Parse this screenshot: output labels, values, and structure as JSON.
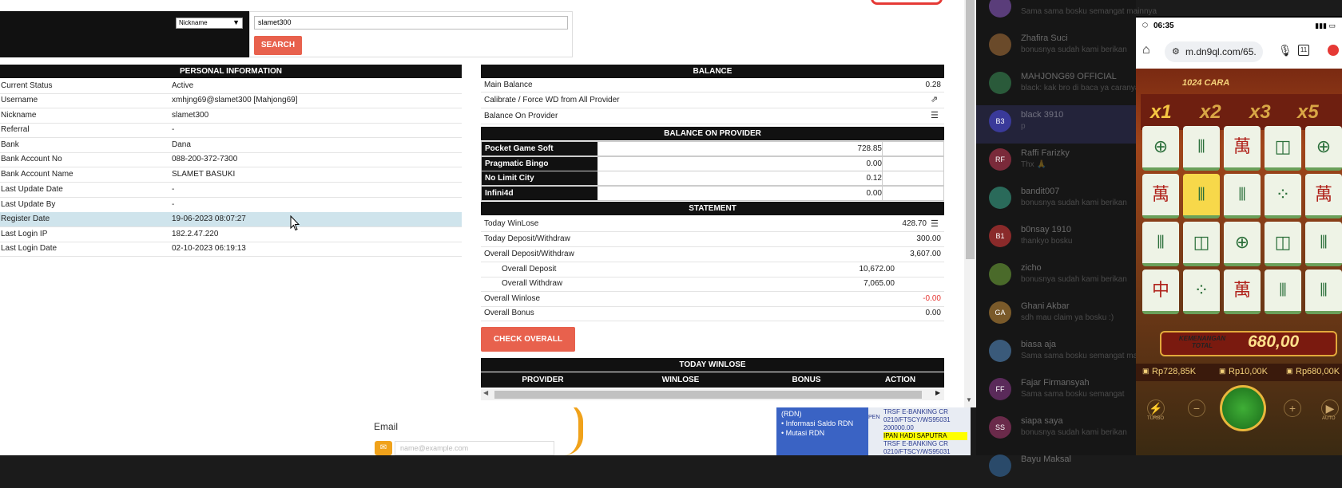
{
  "search": {
    "field_select": "Nickname",
    "query": "slamet300",
    "button": "SEARCH"
  },
  "personal": {
    "header": "PERSONAL INFORMATION",
    "rows": [
      {
        "label": "Current Status",
        "value": "Active"
      },
      {
        "label": "Username",
        "value": "xmhjng69@slamet300  [Mahjong69]"
      },
      {
        "label": "Nickname",
        "value": "slamet300"
      },
      {
        "label": "Referral",
        "value": "-"
      },
      {
        "label": "Bank",
        "value": "Dana"
      },
      {
        "label": "Bank Account No",
        "value": "088-200-372-7300"
      },
      {
        "label": "Bank Account Name",
        "value": "SLAMET BASUKI"
      },
      {
        "label": "Last Update Date",
        "value": "-"
      },
      {
        "label": "Last Update By",
        "value": "-"
      },
      {
        "label": "Register Date",
        "value": "19-06-2023 08:07:27"
      },
      {
        "label": "Last Login IP",
        "value": "182.2.47.220"
      },
      {
        "label": "Last Login Date",
        "value": "02-10-2023 06:19:13"
      }
    ]
  },
  "balance": {
    "header": "BALANCE",
    "main_label": "Main Balance",
    "main_value": "0.28",
    "calibrate_label": "Calibrate / Force WD from All Provider",
    "on_provider_label": "Balance On Provider",
    "provider_header": "BALANCE ON PROVIDER",
    "providers": [
      {
        "name": "Pocket Game Soft",
        "amount": "728.85"
      },
      {
        "name": "Pragmatic Bingo",
        "amount": "0.00"
      },
      {
        "name": "No Limit City",
        "amount": "0.12"
      },
      {
        "name": "Infini4d",
        "amount": "0.00"
      }
    ]
  },
  "statement": {
    "header": "STATEMENT",
    "today_winlose_label": "Today WinLose",
    "today_winlose": "428.70",
    "today_dw_label": "Today Deposit/Withdraw",
    "today_dw": "300.00",
    "overall_dw_label": "Overall Deposit/Withdraw",
    "overall_dw": "3,607.00",
    "overall_deposit_label": "Overall Deposit",
    "overall_deposit": "10,672.00",
    "overall_withdraw_label": "Overall Withdraw",
    "overall_withdraw": "7,065.00",
    "overall_winlose_label": "Overall Winlose",
    "overall_winlose": "-0.00",
    "overall_bonus_label": "Overall Bonus",
    "overall_bonus": "0.00"
  },
  "check_overall_button": "CHECK OVERALL",
  "today_winlose": {
    "header": "TODAY WINLOSE",
    "columns": [
      "PROVIDER",
      "WINLOSE",
      "BONUS",
      "ACTION"
    ]
  },
  "background_page": {
    "email_label": "Email",
    "email_placeholder": "name@example.com",
    "rdn_menu": [
      "(RDN)",
      "• Informasi Saldo RDN",
      "• Mutasi RDN"
    ],
    "pend_label": "PEND",
    "transactions": [
      "TRSF E-BANKING CR 0210/FTSCY/WS95031 200000.00",
      "IPAN HADI SAPUTRA",
      "TRSF E-BANKING CR 0210/FTSCY/WS95031"
    ]
  },
  "chat": [
    {
      "name": "",
      "message": "Sama sama bosku semangat mainnya",
      "initials": ""
    },
    {
      "name": "Zhafira Suci",
      "message": "bonusnya sudah kami berikan",
      "initials": ""
    },
    {
      "name": "MAHJONG69 OFFICIAL",
      "message": "black: kak bro di baca ya caranya",
      "initials": ""
    },
    {
      "name": "black 3910",
      "message": "p",
      "initials": "B3"
    },
    {
      "name": "Raffi Farizky",
      "message": "Thx 🙏",
      "initials": "RF"
    },
    {
      "name": "bandit007",
      "message": "bonusnya sudah kami berikan",
      "initials": ""
    },
    {
      "name": "b0nsay 1910",
      "message": "thankyo bosku",
      "initials": "B1"
    },
    {
      "name": "zicho",
      "message": "bonusnya sudah kami berikan",
      "initials": ""
    },
    {
      "name": "Ghani Akbar",
      "message": "sdh mau claim ya bosku :)",
      "initials": "GA"
    },
    {
      "name": "biasa aja",
      "message": "Sama sama bosku semangat mainnya",
      "initials": ""
    },
    {
      "name": "Fajar Firmansyah",
      "message": "Sama sama bosku semangat",
      "initials": "FF"
    },
    {
      "name": "siapa saya",
      "message": "bonusnya sudah kami berikan",
      "initials": "SS"
    },
    {
      "name": "Bayu Maksal",
      "message": "",
      "initials": ""
    }
  ],
  "phone": {
    "time": "06:35",
    "url": "m.dn9ql.com/65.",
    "tab_count": "11",
    "game": {
      "ways": "1024 CARA",
      "multipliers": [
        "x1",
        "x2",
        "x3",
        "x5"
      ],
      "win_label": "KEMENANGAN TOTAL",
      "win_amount": "680,00",
      "balance": "Rp728,85K",
      "bet": "Rp10,00K",
      "win": "Rp680,00K",
      "turbo_label": "TURBO",
      "auto_label": "AUTO"
    }
  },
  "colors": {
    "accent": "#e8614d",
    "header_bg": "#111111",
    "selected_row": "#cfe4ec",
    "negative": "#e53935"
  }
}
